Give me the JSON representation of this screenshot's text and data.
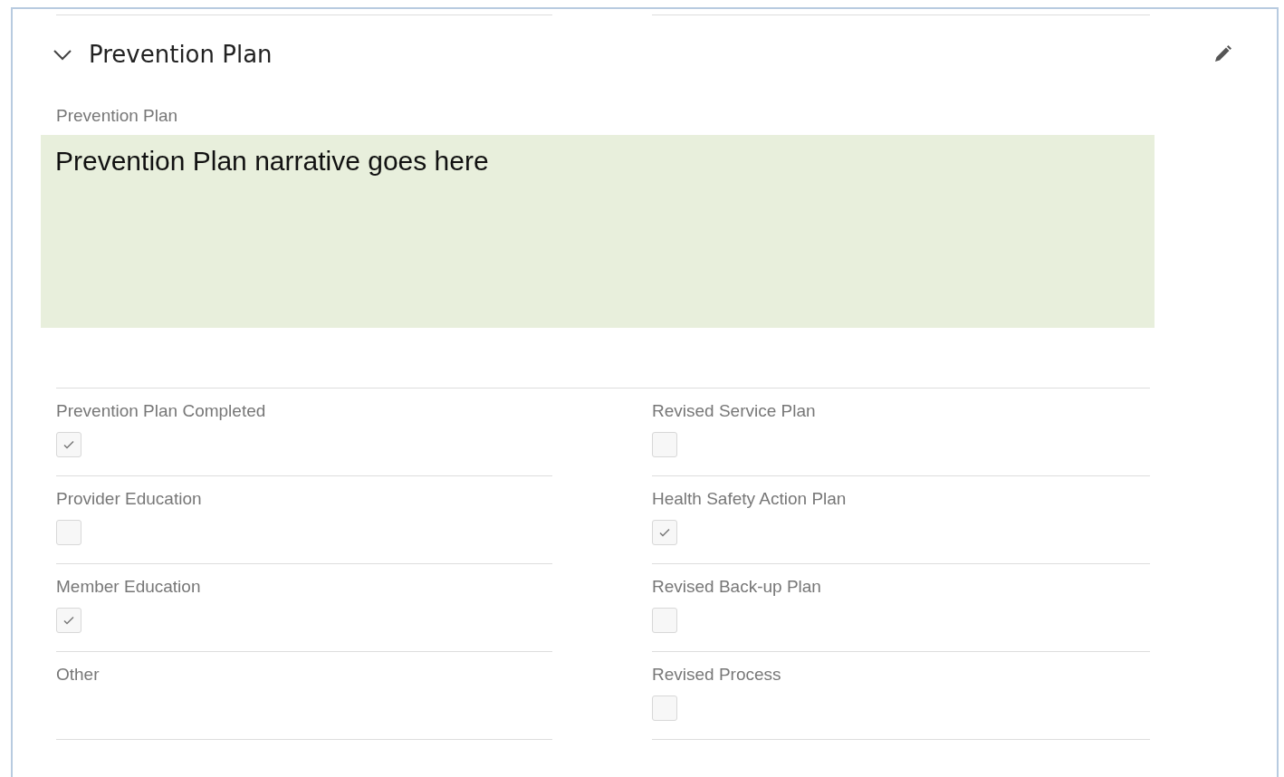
{
  "section": {
    "title": "Prevention Plan",
    "expanded": true
  },
  "narrative": {
    "label": "Prevention Plan",
    "value": "Prevention Plan narrative goes here"
  },
  "fields": [
    {
      "kind": "checkbox",
      "label": "Prevention Plan Completed",
      "checked": true
    },
    {
      "kind": "checkbox",
      "label": "Revised Service Plan",
      "checked": false
    },
    {
      "kind": "checkbox",
      "label": "Provider Education",
      "checked": false
    },
    {
      "kind": "checkbox",
      "label": "Health Safety Action Plan",
      "checked": true
    },
    {
      "kind": "checkbox",
      "label": "Member Education",
      "checked": true
    },
    {
      "kind": "checkbox",
      "label": "Revised Back-up Plan",
      "checked": false
    },
    {
      "kind": "text",
      "label": "Other"
    },
    {
      "kind": "checkbox",
      "label": "Revised Process",
      "checked": false
    }
  ]
}
